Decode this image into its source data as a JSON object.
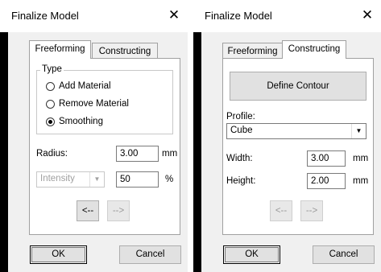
{
  "left": {
    "title": "Finalize Model",
    "close_glyph": "✕",
    "tabs": {
      "freeforming": "Freeforming",
      "constructing": "Constructing"
    },
    "type_group": {
      "label": "Type",
      "options": [
        {
          "label": "Add Material",
          "selected": false
        },
        {
          "label": "Remove Material",
          "selected": false
        },
        {
          "label": "Smoothing",
          "selected": true
        }
      ]
    },
    "radius": {
      "label": "Radius:",
      "value": "3.00",
      "unit": "mm"
    },
    "intensity": {
      "select_value": "Intensity",
      "value": "50",
      "unit": "%"
    },
    "nav": {
      "back": "<--",
      "forward": "-->"
    },
    "buttons": {
      "ok": "OK",
      "cancel": "Cancel"
    }
  },
  "right": {
    "title": "Finalize Model",
    "close_glyph": "✕",
    "tabs": {
      "freeforming": "Freeforming",
      "constructing": "Constructing"
    },
    "define_contour": "Define Contour",
    "profile": {
      "label": "Profile:",
      "value": "Cube"
    },
    "width": {
      "label": "Width:",
      "value": "3.00",
      "unit": "mm"
    },
    "height": {
      "label": "Height:",
      "value": "2.00",
      "unit": "mm"
    },
    "nav": {
      "back": "<--",
      "forward": "-->"
    },
    "buttons": {
      "ok": "OK",
      "cancel": "Cancel"
    }
  },
  "colors": {
    "client_bg": "#f0f0f0",
    "panel_bg": "#ffffff",
    "border": "#a0a0a0"
  }
}
